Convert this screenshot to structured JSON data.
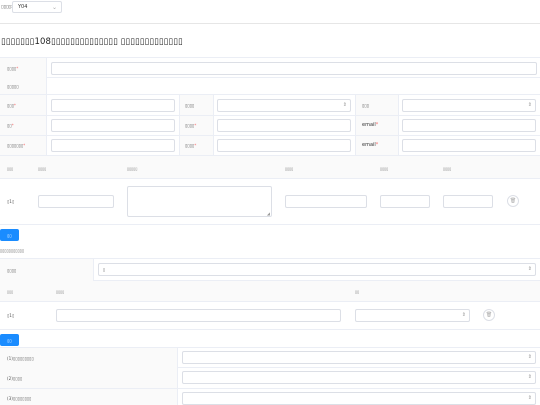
{
  "top": {
    "label": "▯▯▯▯:",
    "select_value": "Y04"
  },
  "title": "▯▯▯▯▯▯▯108▯▯▯▯▯▯▯▯▯▯▯▯▯▯ ▯▯▯▯▯▯▯▯▯▯▯▯▯",
  "form": {
    "r1_label": "▯▯▯▯",
    "r2_label": "▯▯▯▯▯",
    "r3_label_a": "▯▯▯",
    "r3_label_b": "▯▯▯▯",
    "r3_label_c": "▯▯▯",
    "r4_label_a": "▯▯",
    "r4_label_b": "▯▯▯▯",
    "r4_label_c": "email",
    "r5_label_a": "▯▯▯▯▯▯▯",
    "r5_label_b": "▯▯▯▯",
    "r5_label_c": "email",
    "required_mark": "*"
  },
  "table1": {
    "headers": [
      "▯▯▯",
      "▯▯▯▯",
      "▯▯▯▯▯",
      "▯▯▯▯",
      "▯▯▯▯",
      "▯▯▯▯"
    ],
    "row_label": "▯1▯",
    "add_button": "▯▯"
  },
  "section2": {
    "heading": "▯▯▯▯▯▯▯▯▯▯▯",
    "select_label": "▯▯▯▯",
    "select_value": "▯",
    "headers": [
      "▯▯▯",
      "▯▯▯▯",
      "▯▯"
    ],
    "row_label": "▯1▯",
    "add_button": "▯▯"
  },
  "questions": [
    {
      "label": "(1)▯▯▯▯▯▯▯▯▯"
    },
    {
      "label": "(2)▯▯▯▯"
    },
    {
      "label": "(3)▯▯▯▯▯▯▯▯"
    }
  ],
  "icons": {
    "chevron": "chevron-down-icon",
    "arrows": "sort-arrows-icon",
    "trash": "trash-icon"
  },
  "colors": {
    "primary": "#1a8cff",
    "required": "#f56c6c",
    "border": "#dcdfe6"
  }
}
